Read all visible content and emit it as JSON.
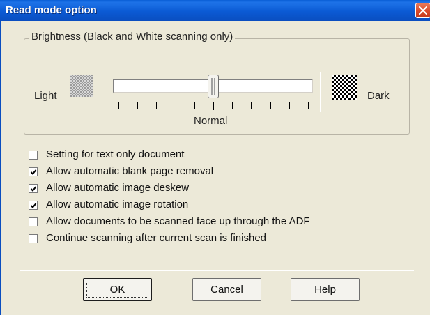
{
  "window": {
    "title": "Read mode option"
  },
  "brightness": {
    "group_label": "Brightness (Black and White scanning only)",
    "light_label": "Light",
    "dark_label": "Dark",
    "normal_label": "Normal",
    "slider_position": 0.5,
    "tick_count": 11
  },
  "options": [
    {
      "label": "Setting for text only document",
      "checked": false
    },
    {
      "label": "Allow automatic blank page removal",
      "checked": true
    },
    {
      "label": "Allow automatic image deskew",
      "checked": true
    },
    {
      "label": "Allow automatic image rotation",
      "checked": true
    },
    {
      "label": "Allow documents to be scanned face up through the ADF",
      "checked": false
    },
    {
      "label": "Continue scanning after current scan is finished",
      "checked": false
    }
  ],
  "buttons": {
    "ok_label": "OK",
    "cancel_label": "Cancel",
    "help_label": "Help"
  },
  "colors": {
    "titlebar": "#0a5fd6",
    "dialog_background": "#ece9d8",
    "close_button": "#d94a2a"
  }
}
